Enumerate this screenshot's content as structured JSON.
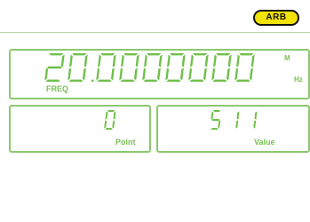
{
  "mode": {
    "label": "ARB"
  },
  "frequency": {
    "digits": "20.0000000",
    "unit_prefix": "M",
    "unit": "Hz",
    "label": "FREQ"
  },
  "point": {
    "value": "0",
    "label": "Point"
  },
  "value": {
    "value": "511",
    "label": "Value"
  },
  "colors": {
    "segment": "#6fc04a",
    "panel_border": "#8cc870",
    "badge_fill": "#f2e206",
    "badge_border": "#111111"
  }
}
